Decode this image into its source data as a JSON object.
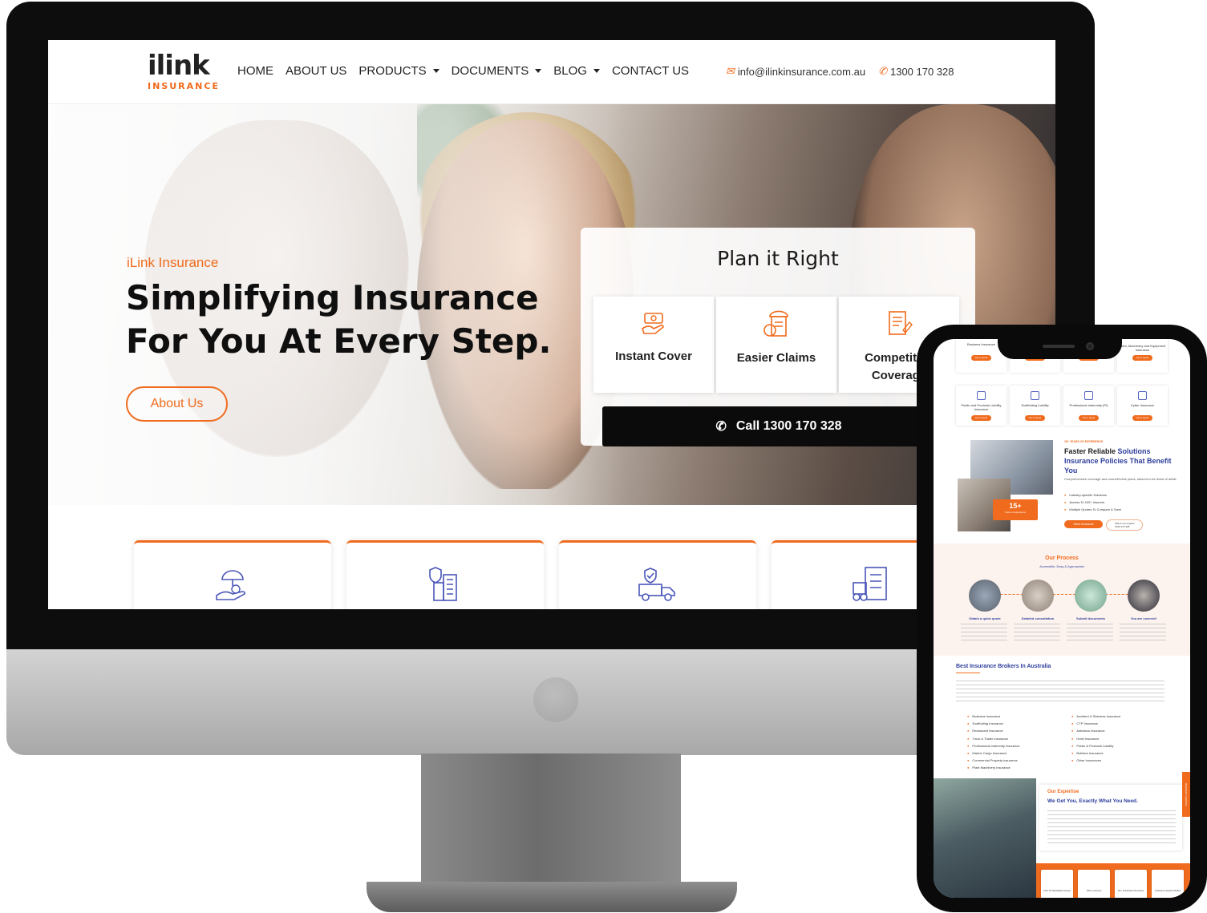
{
  "desktop": {
    "logo": {
      "brand": "ilink",
      "tagline": "INSURANCE"
    },
    "nav": [
      "HOME",
      "ABOUT US",
      "PRODUCTS",
      "DOCUMENTS",
      "BLOG",
      "CONTACT US"
    ],
    "contact": {
      "email": "info@ilinkinsurance.com.au",
      "phone": "1300 170 328"
    },
    "hero": {
      "kicker": "iLink Insurance",
      "title": "Simplifying Insurance For You At Every Step.",
      "cta": "About Us"
    },
    "plan": {
      "title": "Plan it Right",
      "cards": [
        "Instant Cover",
        "Easier Claims",
        "Competitive Coverage"
      ],
      "call_label": "Call 1300 170 328"
    }
  },
  "mobile": {
    "top_cards": [
      "Business Insurance",
      "Insurance",
      "Insurance",
      "Plant, Machinery and Equipment Insurance"
    ],
    "grid_cards": [
      "Public and Products Liability Insurance",
      "Scaffolding Liability",
      "Professional Indemnity (PI)",
      "Cyber Insurance"
    ],
    "quote_btn": "Get a quote",
    "experience": {
      "kicker": "15+ YEARS OF EXPERIENCE",
      "title_a": "Faster Reliable",
      "title_b": "Solutions",
      "title_c": "Insurance Policies That Benefit You",
      "desc": "Comprehensive coverage and cost-effective plans, tailored to its finest of detail.",
      "points": [
        "Industry-specific Solutions",
        "Access To 100+ Insurers",
        "Multiple Quotes To Compare & Save"
      ],
      "badge_num": "15+",
      "badge_txt": "Years of experience",
      "btn": "Other Insurance",
      "talk_label": "Talk to our experts",
      "talk_phone": "1300 170 328"
    },
    "process": {
      "title": "Our Process",
      "sub": "Accessible, Easy & Appropriate",
      "steps": [
        "Obtain a quick quote",
        "Detailed consultation",
        "Submit documents",
        "You are covered!"
      ]
    },
    "brokers": {
      "title": "Best Insurance Brokers In Australia",
      "col1": [
        "Business Insurance",
        "Scaffolding Insurance",
        "Restaurant Insurance",
        "Truck & Trailer Insurance",
        "Professional Indemnity Insurance",
        "Marine Cargo Insurance",
        "Commercial Property Insurance",
        "Plant Machinery Insurance"
      ],
      "col2": [
        "Accident & Sickness Insurance",
        "CTP Insurance",
        "Asbestos Insurance",
        "Hotel Insurance",
        "Public & Products Liability",
        "Builders Insurance",
        "Other Insurances"
      ]
    },
    "expertise": {
      "kicker": "Our Expertise",
      "title": "We Get You, Exactly What You Need.",
      "side_tab": "REQUEST A QUOTE"
    },
    "stats": [
      "Part Of SteadFast Group",
      "100+ Insurers",
      "10+ Industries Presence",
      "Customer-Centric Policy"
    ]
  }
}
